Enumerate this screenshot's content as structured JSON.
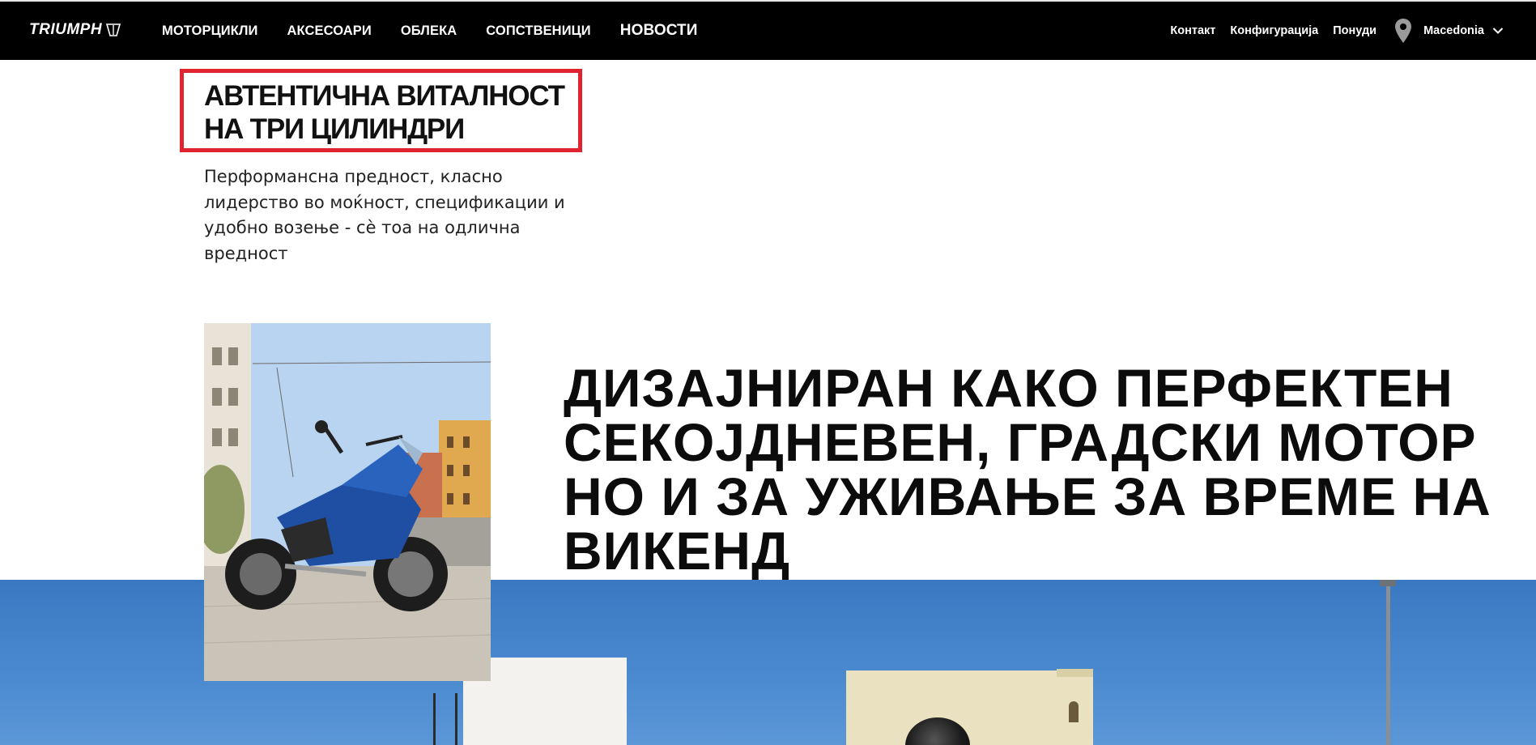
{
  "nav": {
    "logo": "TRIUMPH",
    "items": [
      {
        "label": "МОТОРЦИКЛИ"
      },
      {
        "label": "АКСЕСОАРИ"
      },
      {
        "label": "ОБЛЕКА"
      },
      {
        "label": "СОПСТВЕНИЦИ"
      },
      {
        "label": "НОВОСТИ"
      }
    ],
    "utility": [
      {
        "label": "Контакт"
      },
      {
        "label": "Конфигурација"
      },
      {
        "label": "Понуди"
      }
    ],
    "region": "Macedonia"
  },
  "intro": {
    "title": "АВТЕНТИЧНА ВИТАЛНОСТ НА ТРИ ЦИЛИНДРИ",
    "text": "Перформансна предност, класно лидерство во моќност, спецификации и удобно возење - сè тоа на одлична вредност"
  },
  "headline": "ДИЗАЈНИРАН КАКО ПЕРФЕКТЕН СЕКОЈДНЕВЕН, ГРАДСКИ МОТОР НО И ЗА УЖИВАЊЕ ЗА ВРЕМЕ НА ВИКЕНД",
  "colors": {
    "nav_bg": "#000000",
    "highlight": "#e0232f",
    "band": "#3f7ec6"
  },
  "icons": {
    "region": "map-pin-icon",
    "dropdown": "chevron-down-icon"
  }
}
